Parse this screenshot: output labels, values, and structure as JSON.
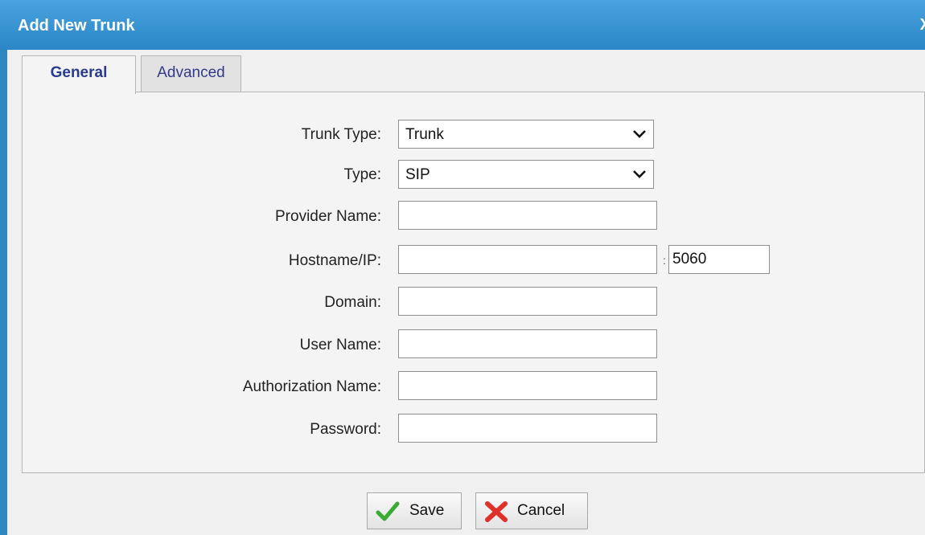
{
  "dialog": {
    "title": "Add New Trunk",
    "close_label": "X"
  },
  "tabs": [
    {
      "label": "General",
      "active": true
    },
    {
      "label": "Advanced",
      "active": false
    }
  ],
  "form": {
    "trunk_type": {
      "label": "Trunk Type:",
      "value": "Trunk"
    },
    "type": {
      "label": "Type:",
      "value": "SIP"
    },
    "provider_name": {
      "label": "Provider Name:",
      "value": ""
    },
    "hostname": {
      "label": "Hostname/IP:",
      "value": "",
      "port_separator": ":",
      "port": "5060"
    },
    "domain": {
      "label": "Domain:",
      "value": ""
    },
    "user_name": {
      "label": "User Name:",
      "value": ""
    },
    "authorization_name": {
      "label": "Authorization Name:",
      "value": ""
    },
    "password": {
      "label": "Password:",
      "value": ""
    }
  },
  "buttons": {
    "save_label": "Save",
    "cancel_label": "Cancel"
  },
  "icons": {
    "close": "close-icon",
    "dropdown": "chevron-down-icon",
    "save": "checkmark-icon",
    "cancel": "red-x-icon"
  },
  "colors": {
    "title_bar": "#2a86c6",
    "tab_text": "#2a3b8f",
    "checkmark": "#3aaa35",
    "cancel_x": "#e0302a"
  }
}
